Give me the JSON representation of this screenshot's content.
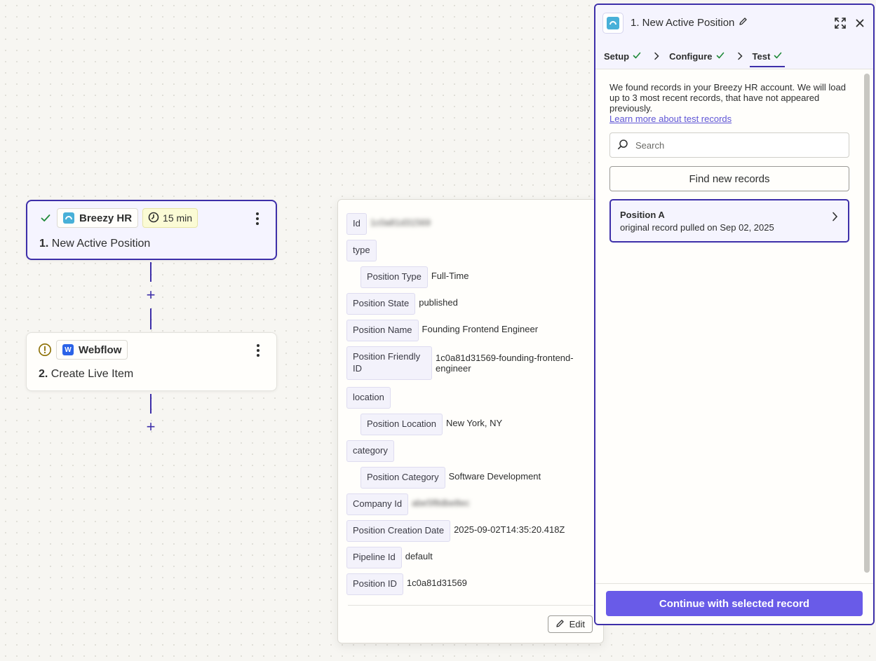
{
  "colors": {
    "accent": "#3d2fa9",
    "button_primary": "#695be8",
    "success": "#1f8a3a",
    "warning": "#8a6d00"
  },
  "steps": [
    {
      "status": "success",
      "app_name": "Breezy HR",
      "schedule": "15 min",
      "number": "1.",
      "title": "New Active Position",
      "icon": "breezy-logo-icon"
    },
    {
      "status": "warning",
      "app_name": "Webflow",
      "number": "2.",
      "title": "Create Live Item",
      "icon": "webflow-logo-icon"
    }
  ],
  "record_detail": {
    "fields": [
      {
        "key": "Id",
        "value": "1c0a81d31569",
        "blurred": true
      },
      {
        "key": "type",
        "value": ""
      },
      {
        "key": "Position Type",
        "value": "Full-Time"
      },
      {
        "key": "Position State",
        "value": "published"
      },
      {
        "key": "Position Name",
        "value": "Founding Frontend Engineer"
      },
      {
        "key": "Position Friendly ID",
        "value": "1c0a81d31569-founding-frontend-engineer"
      },
      {
        "key": "location",
        "value": ""
      },
      {
        "key": "Position Location",
        "value": "New York, NY"
      },
      {
        "key": "category",
        "value": ""
      },
      {
        "key": "Position Category",
        "value": "Software Development"
      },
      {
        "key": "Company Id",
        "value": "abe5f8dbe8ec",
        "blurred": true
      },
      {
        "key": "Position Creation Date",
        "value": "2025-09-02T14:35:20.418Z"
      },
      {
        "key": "Pipeline Id",
        "value": "default"
      },
      {
        "key": "Position ID",
        "value": "1c0a81d31569"
      }
    ],
    "edit_label": "Edit"
  },
  "panel": {
    "title": "1. New Active Position",
    "tabs": [
      {
        "label": "Setup",
        "complete": true
      },
      {
        "label": "Configure",
        "complete": true
      },
      {
        "label": "Test",
        "complete": true,
        "current": true
      }
    ],
    "message": "We found records in your Breezy HR account. We will load up to 3 most recent records, that have not appeared previously.",
    "learn_more": "Learn more about test records",
    "search_placeholder": "Search",
    "find_button": "Find new records",
    "record": {
      "title": "Position A",
      "subtitle": "original record pulled on Sep 02, 2025"
    },
    "continue_button": "Continue with selected record"
  }
}
